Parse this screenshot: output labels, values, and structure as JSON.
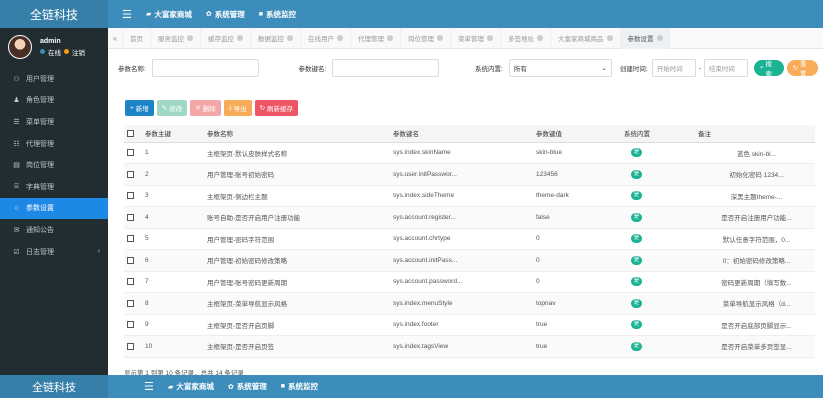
{
  "brand": "全链科技",
  "top_menu": [
    {
      "icon": "shop-icon",
      "glyph": "▰",
      "label": "大富家商城"
    },
    {
      "icon": "gear-icon",
      "glyph": "✿",
      "label": "系统管理"
    },
    {
      "icon": "monitor-icon",
      "glyph": "■",
      "label": "系统监控"
    }
  ],
  "user": {
    "name": "admin",
    "online": "在线",
    "logout": "注销"
  },
  "sidebar": {
    "items": [
      {
        "label": "用户管理",
        "glyph": "⚇"
      },
      {
        "label": "角色管理",
        "glyph": "♟"
      },
      {
        "label": "菜单管理",
        "glyph": "☰"
      },
      {
        "label": "代理管理",
        "glyph": "☷"
      },
      {
        "label": "岗位管理",
        "glyph": "▤"
      },
      {
        "label": "字典管理",
        "glyph": "⌸"
      },
      {
        "label": "参数设置",
        "glyph": "○"
      },
      {
        "label": "通知公告",
        "glyph": "✉"
      },
      {
        "label": "日志管理",
        "glyph": "☑"
      }
    ],
    "active_index": 6
  },
  "tabs": [
    {
      "label": "首页",
      "closable": false
    },
    {
      "label": "服务监控",
      "closable": true
    },
    {
      "label": "缓存监控",
      "closable": true
    },
    {
      "label": "数据监控",
      "closable": true
    },
    {
      "label": "在线用户",
      "closable": true
    },
    {
      "label": "代理管理",
      "closable": true
    },
    {
      "label": "岗位管理",
      "closable": true
    },
    {
      "label": "菜单管理",
      "closable": true
    },
    {
      "label": "多签地址",
      "closable": true
    },
    {
      "label": "大富家商城商品",
      "closable": true
    },
    {
      "label": "参数设置",
      "closable": true
    }
  ],
  "search": {
    "param_name_label": "参数名称:",
    "param_name_value": "",
    "param_key_label": "参数键名:",
    "param_key_value": "",
    "builtin_label": "系统内置:",
    "builtin_value": "所有",
    "created_label": "创建时间:",
    "start_placeholder": "开始时间",
    "end_placeholder": "结束时间",
    "dash": "-",
    "search_btn": "搜索",
    "reset_btn": "重置"
  },
  "toolbar": {
    "add": "新增",
    "edit": "修改",
    "delete": "删除",
    "export": "导出",
    "refresh_cache": "刷新缓存"
  },
  "table": {
    "headers": [
      "参数主键",
      "参数名称",
      "参数键名",
      "参数键值",
      "系统内置",
      "备注"
    ],
    "rows": [
      {
        "id": "1",
        "name": "主框架页-默认皮肤样式名称",
        "key": "sys.index.skinName",
        "value": "skin-blue",
        "builtin": "是",
        "remark": "蓝色 skin-bl..."
      },
      {
        "id": "2",
        "name": "用户管理-账号初始密码",
        "key": "sys.user.initPasswor...",
        "value": "123456",
        "builtin": "是",
        "remark": "初始化密码 1234..."
      },
      {
        "id": "3",
        "name": "主框架页-侧边栏主题",
        "key": "sys.index.sideTheme",
        "value": "theme-dark",
        "builtin": "是",
        "remark": "深黑主题theme-..."
      },
      {
        "id": "4",
        "name": "账号自助-是否开启用户注册功能",
        "key": "sys.account.register...",
        "value": "false",
        "builtin": "是",
        "remark": "是否开启注册用户功能..."
      },
      {
        "id": "5",
        "name": "用户管理-密码字符范围",
        "key": "sys.account.chrtype",
        "value": "0",
        "builtin": "是",
        "remark": "默认任意字符范围，0..."
      },
      {
        "id": "6",
        "name": "用户管理-初始密码修改策略",
        "key": "sys.account.initPass...",
        "value": "0",
        "builtin": "是",
        "remark": "0：初始密码修改策略..."
      },
      {
        "id": "7",
        "name": "用户管理-账号密码更新周期",
        "key": "sys.account.password...",
        "value": "0",
        "builtin": "是",
        "remark": "密码更新周期（填写数..."
      },
      {
        "id": "8",
        "name": "主框架页-菜单导航显示风格",
        "key": "sys.index.menuStyle",
        "value": "topnav",
        "builtin": "是",
        "remark": "菜单导航显示风格（d..."
      },
      {
        "id": "9",
        "name": "主框架页-是否开启页脚",
        "key": "sys.index.footer",
        "value": "true",
        "builtin": "是",
        "remark": "是否开启底部页脚显示..."
      },
      {
        "id": "10",
        "name": "主框架页-是否开启页签",
        "key": "sys.index.tagsView",
        "value": "true",
        "builtin": "是",
        "remark": "是否开启菜单多页签显..."
      }
    ]
  },
  "pager_text": "显示第 1 到第 10 条记录，总共 14 条记录"
}
